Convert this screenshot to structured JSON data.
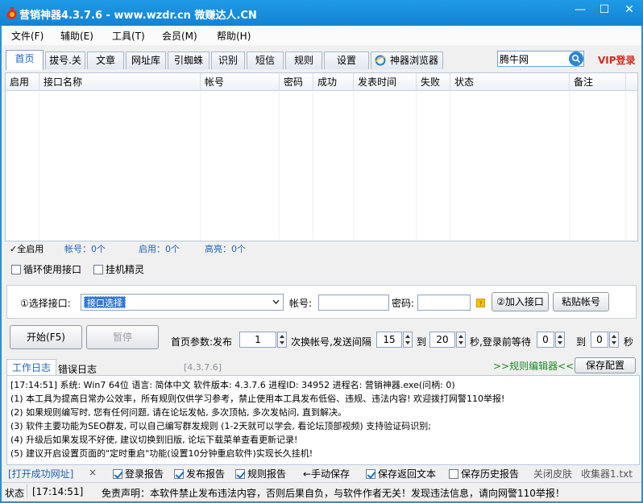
{
  "window": {
    "title": "营销神器4.3.7.6 - www.wzdr.cn 微赚达人.CN",
    "minimize": "—",
    "maximize": "☐",
    "close": "✕"
  },
  "menu": [
    "文件(F)",
    "辅助(E)",
    "工具(T)",
    "会员(M)",
    "帮助(H)"
  ],
  "tabs": [
    "首页",
    "拔号.关",
    "文章",
    "网址库",
    "引蜘蛛",
    "识别",
    "短信",
    "规则",
    "设置",
    "神器浏览器"
  ],
  "search": {
    "value": "腾牛网"
  },
  "vip_login": "VIP登录",
  "table": {
    "columns": [
      "启用",
      "接口名称",
      "帐号",
      "密码",
      "成功",
      "发表时间",
      "失败",
      "状态",
      "备注"
    ]
  },
  "stats": {
    "enable_all": "全启用",
    "account_count": "帐号：0个",
    "enabled_count": "启用：0个",
    "highlight_count": "高亮：0个"
  },
  "options": {
    "loop_interface": "循环使用接口",
    "hang_sprite": "挂机精灵"
  },
  "iface": {
    "select_label": "①选择接口:",
    "select_value": "接口选择",
    "account_label": "帐号:",
    "password_label": "密码:",
    "badge": "?",
    "add_button": "②加入接口",
    "paste_button": "粘贴帐号"
  },
  "controls": {
    "start": "开始(F5)",
    "pause": "暂停"
  },
  "params": {
    "label": "首页参数:发布",
    "publish_count": "1",
    "switch_label": "次换帐号,发送间隔",
    "interval_min": "15",
    "to1": "到",
    "interval_max": "20",
    "wait_label": "秒,登录前等待",
    "wait_min": "0",
    "to2": "到",
    "wait_max": "0",
    "sec": "秒"
  },
  "log_tabs": {
    "work": "工作日志",
    "error": "错误日志",
    "version": "[4.3.7.6]",
    "rule_editor": ">>规则编辑器<<",
    "save_config": "保存配置"
  },
  "log": [
    "[17:14:51] 系统: Win7 64位 语言: 简体中文 软件版本: 4.3.7.6 进程ID: 34952 进程名: 营销神器.exe(问柄: 0)",
    "(1) 本工具为提高日常办公效率，所有规则仅供学习参考，禁止使用本工具发布低俗、违规、违法内容! 欢迎拨打网警110举报!",
    "(2) 如果规则编写时, 您有任何问题, 请在论坛发帖, 多次顶帖, 多次发帖问, 直到解决。",
    "(3) 软件主要功能为SEO群发, 可以自己编写群发规则 (1-2天就可以学会, 看论坛顶部视频) 支持验证码识别;",
    "(4) 升级后如果发现不好使, 建议切换到旧版, 论坛下载菜单查看更新记录!",
    "(5) 建议开启设置页面的\"定时重启\"功能(设置10分钟重启软件)实现长久挂机!"
  ],
  "bottom": {
    "open_success": "[打开成功网址]",
    "close_x": "×",
    "login_report": "登录报告",
    "publish_report": "发布报告",
    "rule_report": "规则报告",
    "manual_save": "←手动保存",
    "save_return": "保存返回文本",
    "save_history": "保存历史报告",
    "close_skin": "关闭皮肤",
    "collector": "收集器1.txt"
  },
  "status": {
    "label": "状态",
    "time": "[17:14:51]",
    "message": "免责声明：本软件禁止发布违法内容，否则后果自负，与软件作者无关！发现违法信息，请向网警110举报！"
  },
  "colors": {
    "title_bar": "#1383d3",
    "accent_blue": "#1f65b8",
    "vip_red": "#d52b1e",
    "green_link": "#1a8a24"
  }
}
